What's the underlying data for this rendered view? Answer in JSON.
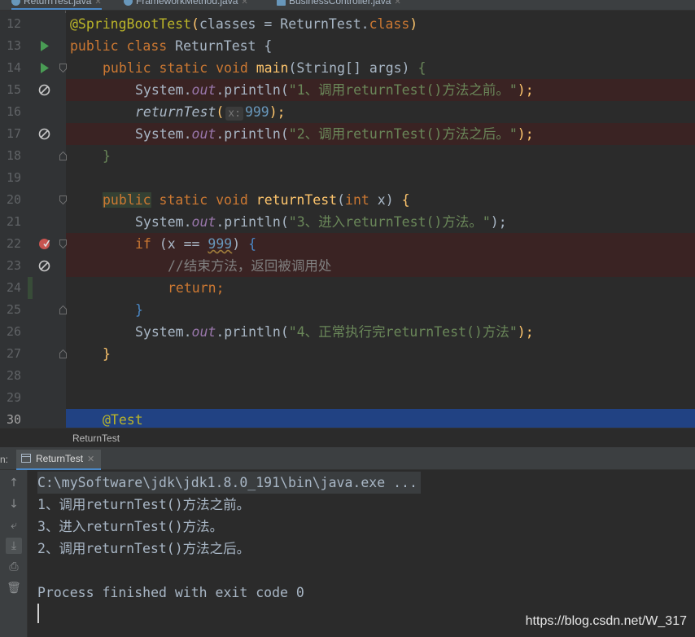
{
  "tabs": [
    {
      "label": "ReturnTest.java",
      "active": true
    },
    {
      "label": "FrameworkMethod.java",
      "active": false
    },
    {
      "label": "BusinessController.java",
      "active": false
    }
  ],
  "editor": {
    "lines": [
      {
        "num": "12"
      },
      {
        "num": "13"
      },
      {
        "num": "14"
      },
      {
        "num": "15"
      },
      {
        "num": "16"
      },
      {
        "num": "17"
      },
      {
        "num": "18"
      },
      {
        "num": "19"
      },
      {
        "num": "20"
      },
      {
        "num": "21"
      },
      {
        "num": "22"
      },
      {
        "num": "23"
      },
      {
        "num": "24"
      },
      {
        "num": "25"
      },
      {
        "num": "26"
      },
      {
        "num": "27"
      },
      {
        "num": "28"
      },
      {
        "num": "29"
      },
      {
        "num": "30"
      }
    ],
    "code": {
      "l12_ann": "@SpringBootTest",
      "l12_paren_open": "(",
      "l12_classes": "classes",
      "l12_eq": " = ReturnTest.",
      "l12_class_kw": "class",
      "l12_paren_close": ")",
      "l13_public": "public class",
      "l13_name": " ReturnTest {",
      "l14_kw": "public static void",
      "l14_main": " main",
      "l14_args": "(String[] args) ",
      "l14_brace": "{",
      "l15_sys": "System.",
      "l15_out": "out",
      "l15_println": ".println(",
      "l15_str": "\"1、调用returnTest()方法之前。\"",
      "l15_end": ");",
      "l16_call": "returnTest",
      "l16_paren": "(",
      "l16_hint": "x:",
      "l16_num": "999",
      "l16_end": ");",
      "l17_sys": "System.",
      "l17_out": "out",
      "l17_println": ".println(",
      "l17_str": "\"2、调用returnTest()方法之后。\"",
      "l17_end": ");",
      "l19_brace": "}",
      "l20_public": "public",
      "l20_kw": " static void",
      "l20_name": " returnTest",
      "l20_paren": "(",
      "l20_int": "int",
      "l20_rest": " x) ",
      "l20_brace": "{",
      "l21_sys": "System.",
      "l21_out": "out",
      "l21_println": ".println(",
      "l21_str": "\"3、进入returnTest()方法。\"",
      "l21_end": ");",
      "l22_if": "if",
      "l22_cond_a": " (x == ",
      "l22_num": "999",
      "l22_cond_b": ") ",
      "l22_brace": "{",
      "l23_cmt": "//结束方法，返回被调用处",
      "l24_ret": "return",
      "l24_semi": ";",
      "l25_brace": "}",
      "l26_sys": "System.",
      "l26_out": "out",
      "l26_println": ".println(",
      "l26_str": "\"4、正常执行完returnTest()方法\"",
      "l26_end": ");",
      "l27_brace": "}",
      "l30_ann": "@Test"
    }
  },
  "breadcrumb": "ReturnTest",
  "run_panel": {
    "label": "n:",
    "tab_label": "ReturnTest",
    "console": [
      "C:\\mySoftware\\jdk\\jdk1.8.0_191\\bin\\java.exe ...",
      "1、调用returnTest()方法之前。",
      "3、进入returnTest()方法。",
      "2、调用returnTest()方法之后。",
      "",
      "Process finished with exit code 0"
    ]
  },
  "watermark": "https://blog.csdn.net/W_317",
  "colors": {
    "background": "#2b2b2b",
    "keyword": "#cc7832",
    "string": "#6a8759",
    "number": "#6897bb",
    "annotation": "#bbb529",
    "current_line": "#214283"
  }
}
